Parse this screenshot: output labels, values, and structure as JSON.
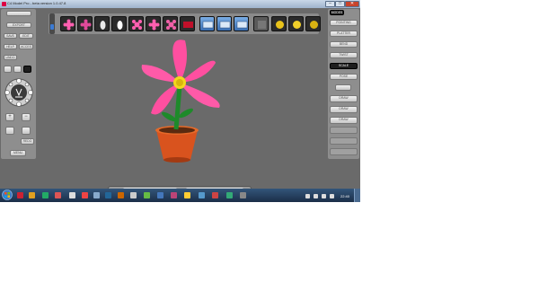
{
  "window": {
    "title": "C4 Model Pro - beta version 1.0.47.8",
    "controls": {
      "minimize": "–",
      "maximize": "□",
      "close": "✕"
    }
  },
  "left_panel": {
    "buttons": [
      "EXPORT",
      "SAVE",
      "EDIT",
      "HELP",
      "ACCES",
      "UNDO",
      "REDO",
      "MENU"
    ],
    "icons": [
      "undo-icon",
      "redo-icon",
      "trash-icon",
      "navigation-icon",
      "zoom-in-icon",
      "zoom-out-icon",
      "tool-icon",
      "search-icon"
    ]
  },
  "right_panel": {
    "modes_label": "MODES",
    "buttons": [
      "POINTING",
      "PLATTER",
      "BEND",
      "TWIST",
      "SCALE",
      "POSE"
    ],
    "active_button": "SCALE",
    "draw_buttons": [
      "DRAW",
      "DRAW",
      "DRAW"
    ]
  },
  "toolbar": {
    "items": [
      "flower-thumb",
      "flower-thumb",
      "vase-thumb",
      "vase-thumb",
      "flower-thumb",
      "flower-thumb",
      "flower-thumb",
      "red-object-thumb",
      "layout-thumb",
      "layout-thumb",
      "layout-thumb",
      "gray-thumb",
      "sphere-thumb",
      "sphere-thumb",
      "sphere-thumb"
    ]
  },
  "viewport": {
    "object": "3d-flower-in-pot"
  },
  "taskbar": {
    "clock": "22:40"
  },
  "colors": {
    "petal": "#ff4fa0",
    "pot": "#d9531e",
    "stem": "#1e8a2a",
    "background": "#6a6a6a"
  }
}
